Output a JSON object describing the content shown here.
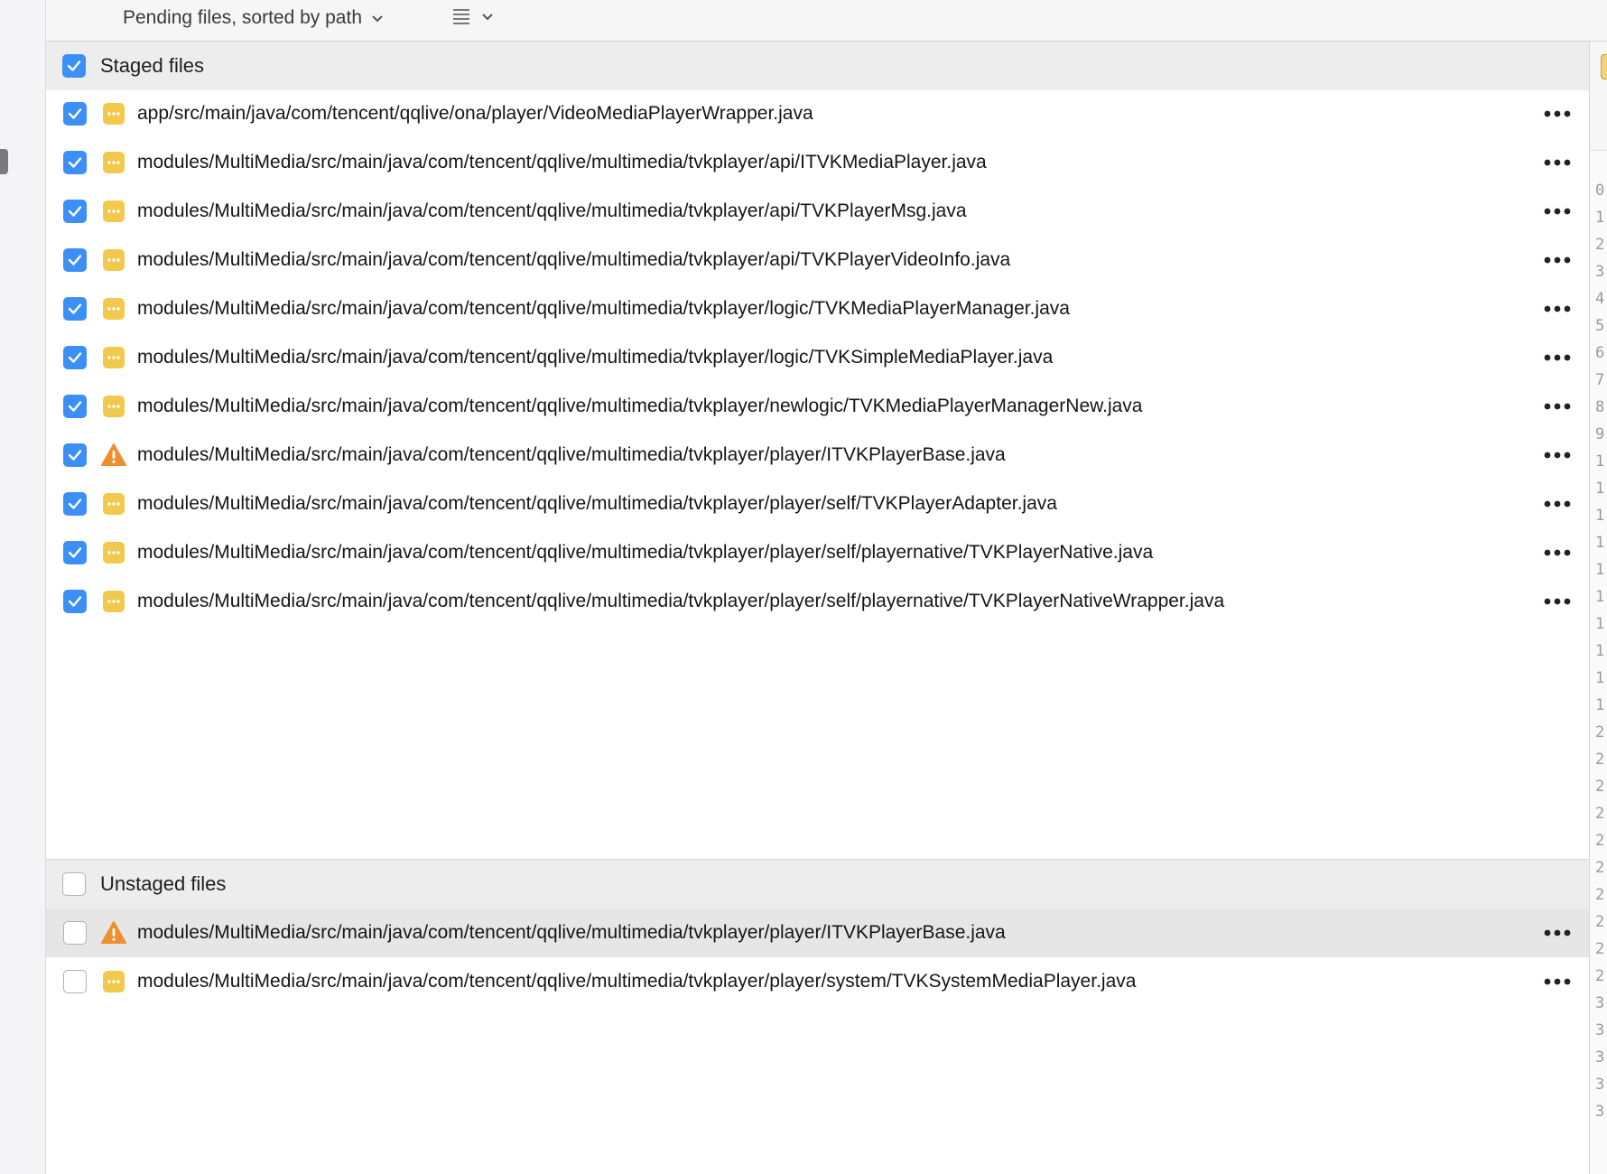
{
  "toolbar": {
    "sort_label": "Pending files, sorted by path",
    "sort_icon": "chevron-down-icon",
    "view_icon": "list-icon"
  },
  "staged": {
    "header": "Staged files",
    "header_checked": true,
    "files": [
      {
        "path": "app/src/main/java/com/tencent/qqlive/ona/player/VideoMediaPlayerWrapper.java",
        "status": "modified",
        "checked": true
      },
      {
        "path": "modules/MultiMedia/src/main/java/com/tencent/qqlive/multimedia/tvkplayer/api/ITVKMediaPlayer.java",
        "status": "modified",
        "checked": true
      },
      {
        "path": "modules/MultiMedia/src/main/java/com/tencent/qqlive/multimedia/tvkplayer/api/TVKPlayerMsg.java",
        "status": "modified",
        "checked": true
      },
      {
        "path": "modules/MultiMedia/src/main/java/com/tencent/qqlive/multimedia/tvkplayer/api/TVKPlayerVideoInfo.java",
        "status": "modified",
        "checked": true
      },
      {
        "path": "modules/MultiMedia/src/main/java/com/tencent/qqlive/multimedia/tvkplayer/logic/TVKMediaPlayerManager.java",
        "status": "modified",
        "checked": true
      },
      {
        "path": "modules/MultiMedia/src/main/java/com/tencent/qqlive/multimedia/tvkplayer/logic/TVKSimpleMediaPlayer.java",
        "status": "modified",
        "checked": true
      },
      {
        "path": "modules/MultiMedia/src/main/java/com/tencent/qqlive/multimedia/tvkplayer/newlogic/TVKMediaPlayerManagerNew.java",
        "status": "modified",
        "checked": true
      },
      {
        "path": "modules/MultiMedia/src/main/java/com/tencent/qqlive/multimedia/tvkplayer/player/ITVKPlayerBase.java",
        "status": "warning",
        "checked": true
      },
      {
        "path": "modules/MultiMedia/src/main/java/com/tencent/qqlive/multimedia/tvkplayer/player/self/TVKPlayerAdapter.java",
        "status": "modified",
        "checked": true
      },
      {
        "path": "modules/MultiMedia/src/main/java/com/tencent/qqlive/multimedia/tvkplayer/player/self/playernative/TVKPlayerNative.java",
        "status": "modified",
        "checked": true
      },
      {
        "path": "modules/MultiMedia/src/main/java/com/tencent/qqlive/multimedia/tvkplayer/player/self/playernative/TVKPlayerNativeWrapper.java",
        "status": "modified",
        "checked": true
      }
    ]
  },
  "unstaged": {
    "header": "Unstaged files",
    "header_checked": false,
    "files": [
      {
        "path": "modules/MultiMedia/src/main/java/com/tencent/qqlive/multimedia/tvkplayer/player/ITVKPlayerBase.java",
        "status": "warning",
        "checked": false,
        "selected": true
      },
      {
        "path": "modules/MultiMedia/src/main/java/com/tencent/qqlive/multimedia/tvkplayer/player/system/TVKSystemMediaPlayer.java",
        "status": "modified",
        "checked": false,
        "selected": false
      }
    ]
  },
  "gutter_numbers": [
    "0",
    "1",
    "2",
    "3",
    "4",
    "5",
    "6",
    "7",
    "8",
    "9",
    "1",
    "1",
    "1",
    "1",
    "1",
    "1",
    "1",
    "1",
    "1",
    "1",
    "2",
    "2",
    "2",
    "2",
    "2",
    "2",
    "2",
    "2",
    "2",
    "2",
    "3",
    "3",
    "3",
    "3",
    "3"
  ],
  "colors": {
    "accent": "#3b8ff6",
    "modified_badge": "#f2c94c",
    "warning": "#ee8f2f"
  }
}
